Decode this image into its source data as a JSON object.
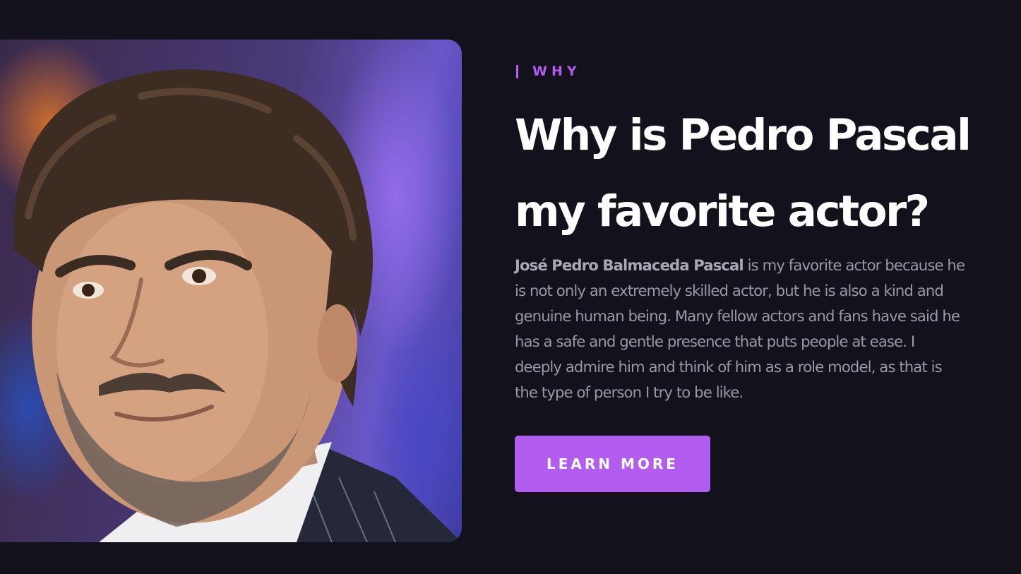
{
  "section": {
    "eyebrow": "WHY",
    "title_lines": [
      "Why is Pedro Pascal",
      "my favorite actor?"
    ],
    "body": {
      "bold_name": "José Pedro Balmaceda Pascal",
      "lines": [
        " is my favorite actor because he",
        "is not only an extremely skilled actor, but he is also a kind and",
        "genuine human being. Many fellow actors and fans have said he",
        "has a safe and gentle presence that puts people at ease. I",
        "deeply admire him and think of him as a role model, as that is",
        "the type of person I try to be like."
      ]
    },
    "cta_label": "LEARN MORE",
    "photo": "portrait-photo"
  },
  "colors": {
    "background": "#13111c",
    "accent": "#b35cf0",
    "heading": "#ffffff",
    "body_text": "#9a98a6"
  }
}
